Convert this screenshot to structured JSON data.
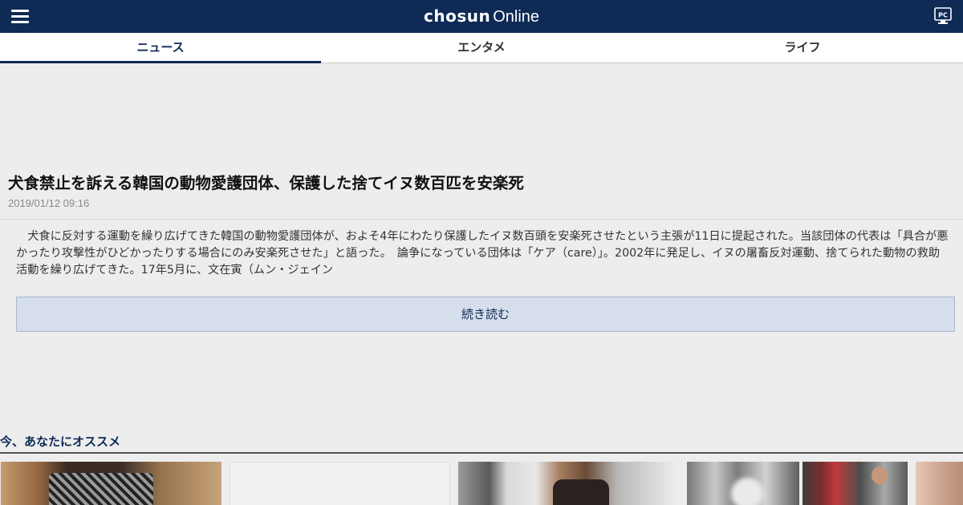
{
  "header": {
    "logo_main": "chosun",
    "logo_sub": "Online",
    "menu_icon": "hamburger-menu-icon",
    "pc_icon": "pc-monitor-icon",
    "pc_label": "PC",
    "bar_color": "#0e2a55"
  },
  "tabs": [
    {
      "label": "ニュース",
      "active": true
    },
    {
      "label": "エンタメ",
      "active": false
    },
    {
      "label": "ライフ",
      "active": false
    }
  ],
  "article": {
    "headline": "犬食禁止を訴える韓国の動物愛護団体、保護した捨てイヌ数百匹を安楽死",
    "date": "2019/01/12 09:16",
    "body": "　犬食に反対する運動を繰り広げてきた韓国の動物愛護団体が、およそ4年にわたり保護したイヌ数百頭を安楽死させたという主張が11日に提起された。当該団体の代表は「具合が悪かったり攻撃性がひどかったりする場合にのみ安楽死させた」と語った。　論争になっている団体は「ケア（care）」。2002年に発足し、イヌの屠畜反対運動、捨てられた動物の救助活動を繰り広げてきた。17年5月に、文在寅（ムン・ジェイン",
    "read_more": "続き読む"
  },
  "recommend": {
    "title": "今、あなたにオススメ"
  }
}
